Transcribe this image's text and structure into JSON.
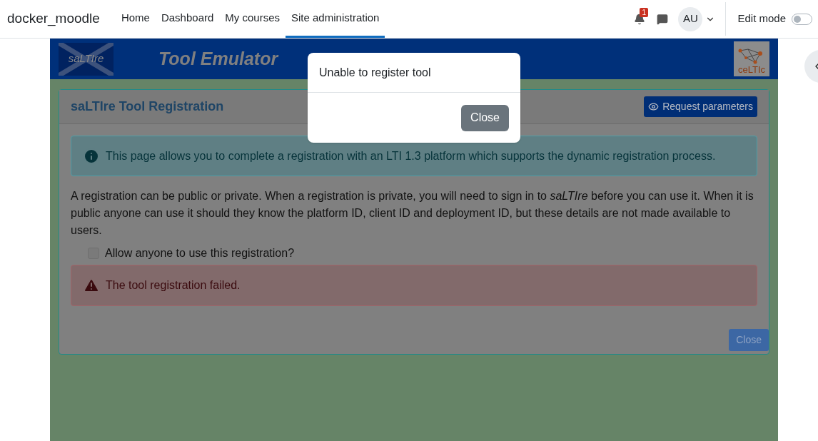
{
  "navbar": {
    "brand": "docker_moodle",
    "links": [
      {
        "label": "Home",
        "selected": false
      },
      {
        "label": "Dashboard",
        "selected": false
      },
      {
        "label": "My courses",
        "selected": false
      },
      {
        "label": "Site administration",
        "selected": true
      }
    ],
    "notification_count": "1",
    "avatar": "AU",
    "edit_mode": {
      "label": "Edit mode",
      "on": false
    }
  },
  "tool": {
    "logo": "saLTIre",
    "title": "Tool Emulator",
    "partner_logo": "ceLTIc",
    "card": {
      "title": "saLTIre Tool Registration",
      "request_button": "Request parameters",
      "info": "This page allows you to complete a registration with an LTI 1.3 platform which supports the dynamic registration process.",
      "paragraph": "A registration can be public or private. When a registration is private, you will need to sign in to *saLTIre* before you can use it. When it is public anyone can use it should they know the platform ID, client ID and deployment ID, but these details are not made available to users.",
      "checkbox": {
        "label": "Allow anyone to use this registration?",
        "checked": false
      },
      "error": "The tool registration failed.",
      "close_button": "Close"
    }
  },
  "modal": {
    "title": "Unable to register tool",
    "close_button": "Close"
  }
}
